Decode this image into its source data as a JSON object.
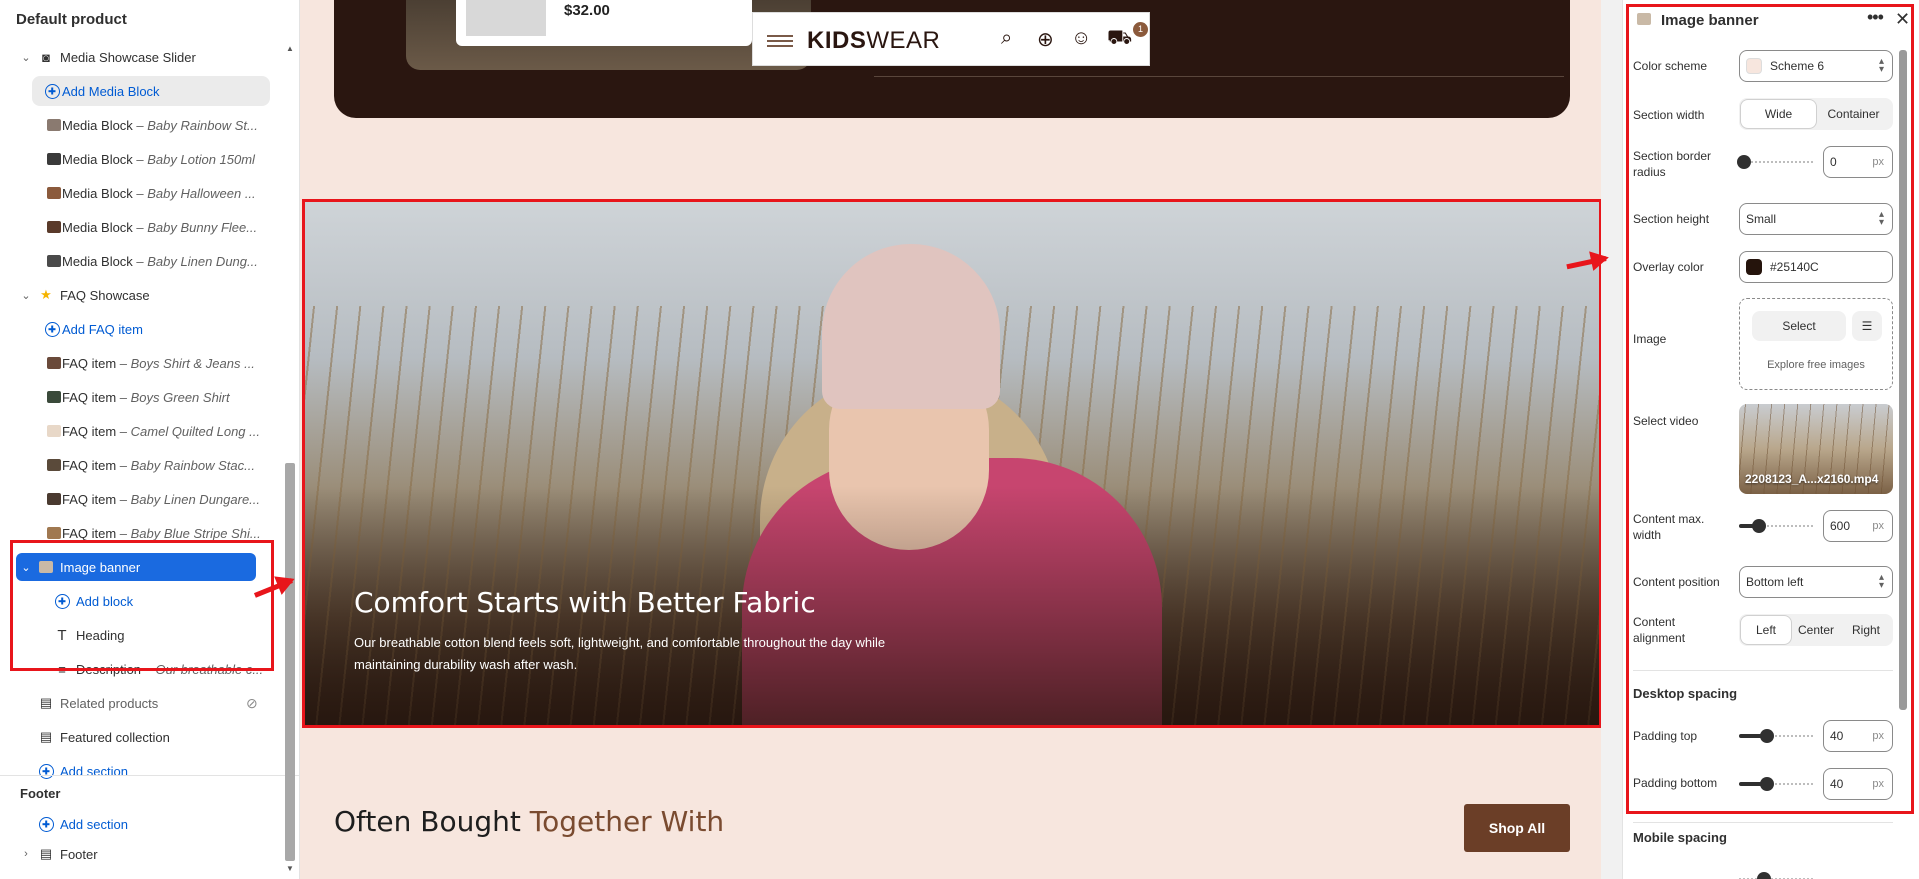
{
  "sidebar": {
    "title": "Default product",
    "items": [
      {
        "label": "Media Showcase Slider",
        "sub": ""
      },
      {
        "label": "Add Media Block",
        "sub": ""
      },
      {
        "label": "Media Block",
        "sub": " – Baby Rainbow St..."
      },
      {
        "label": "Media Block",
        "sub": " – Baby Lotion 150ml"
      },
      {
        "label": "Media Block",
        "sub": " – Baby Halloween ..."
      },
      {
        "label": "Media Block",
        "sub": " – Baby Bunny Flee..."
      },
      {
        "label": "Media Block",
        "sub": " – Baby Linen Dung..."
      },
      {
        "label": "FAQ Showcase",
        "sub": ""
      },
      {
        "label": "Add FAQ item",
        "sub": ""
      },
      {
        "label": "FAQ item",
        "sub": " – Boys Shirt & Jeans ..."
      },
      {
        "label": "FAQ item",
        "sub": " – Boys Green Shirt"
      },
      {
        "label": "FAQ item",
        "sub": " – Camel Quilted Long ..."
      },
      {
        "label": "FAQ item",
        "sub": " – Baby Rainbow Stac..."
      },
      {
        "label": "FAQ item",
        "sub": " – Baby Linen Dungare..."
      },
      {
        "label": "FAQ item",
        "sub": " – Baby Blue Stripe Shi..."
      },
      {
        "label": "Image banner",
        "sub": ""
      },
      {
        "label": "Add block",
        "sub": ""
      },
      {
        "label": "Heading",
        "sub": ""
      },
      {
        "label": "Description",
        "sub": " – Our breathable c..."
      },
      {
        "label": "Related products",
        "sub": ""
      },
      {
        "label": "Featured collection",
        "sub": ""
      },
      {
        "label": "Add section",
        "sub": ""
      }
    ],
    "footer_title": "Footer",
    "footer_add": "Add section",
    "footer_item": "Footer"
  },
  "canvas": {
    "price": "$32.00",
    "logo_bold": "KIDS",
    "logo_light": "WEAR",
    "cart_count": "1",
    "banner_heading": "Comfort Starts with Better Fabric",
    "banner_text": "Our breathable cotton blend feels soft, lightweight, and comfortable throughout the day while maintaining durability wash after wash.",
    "section_title_a": "Often Bought ",
    "section_title_b": "Together With",
    "shop_all": "Shop All"
  },
  "panel": {
    "title": "Image banner",
    "color_scheme_label": "Color scheme",
    "color_scheme_value": "Scheme 6",
    "section_width_label": "Section width",
    "section_width_options": [
      "Wide",
      "Container"
    ],
    "section_width_selected": "Wide",
    "border_radius_label": "Section border radius",
    "border_radius_value": "0",
    "section_height_label": "Section height",
    "section_height_value": "Small",
    "overlay_color_label": "Overlay color",
    "overlay_color_value": "#25140C",
    "image_label": "Image",
    "image_select": "Select",
    "image_explore": "Explore free images",
    "video_label": "Select video",
    "video_name": "2208123_A...x2160.mp4",
    "content_width_label": "Content max. width",
    "content_width_value": "600",
    "content_position_label": "Content position",
    "content_position_value": "Bottom left",
    "content_alignment_label": "Content alignment",
    "content_alignment_options": [
      "Left",
      "Center",
      "Right"
    ],
    "content_alignment_selected": "Left",
    "desktop_spacing": "Desktop spacing",
    "padding_top_label": "Padding top",
    "padding_top_value": "40",
    "padding_bottom_label": "Padding bottom",
    "padding_bottom_value": "40",
    "mobile_spacing": "Mobile spacing",
    "unit": "px"
  },
  "colors": {
    "accent": "#005bd3",
    "selected": "#1a6ae0",
    "highlight": "#e8151b",
    "overlay": "#25140C",
    "brown": "#6b3e27"
  }
}
